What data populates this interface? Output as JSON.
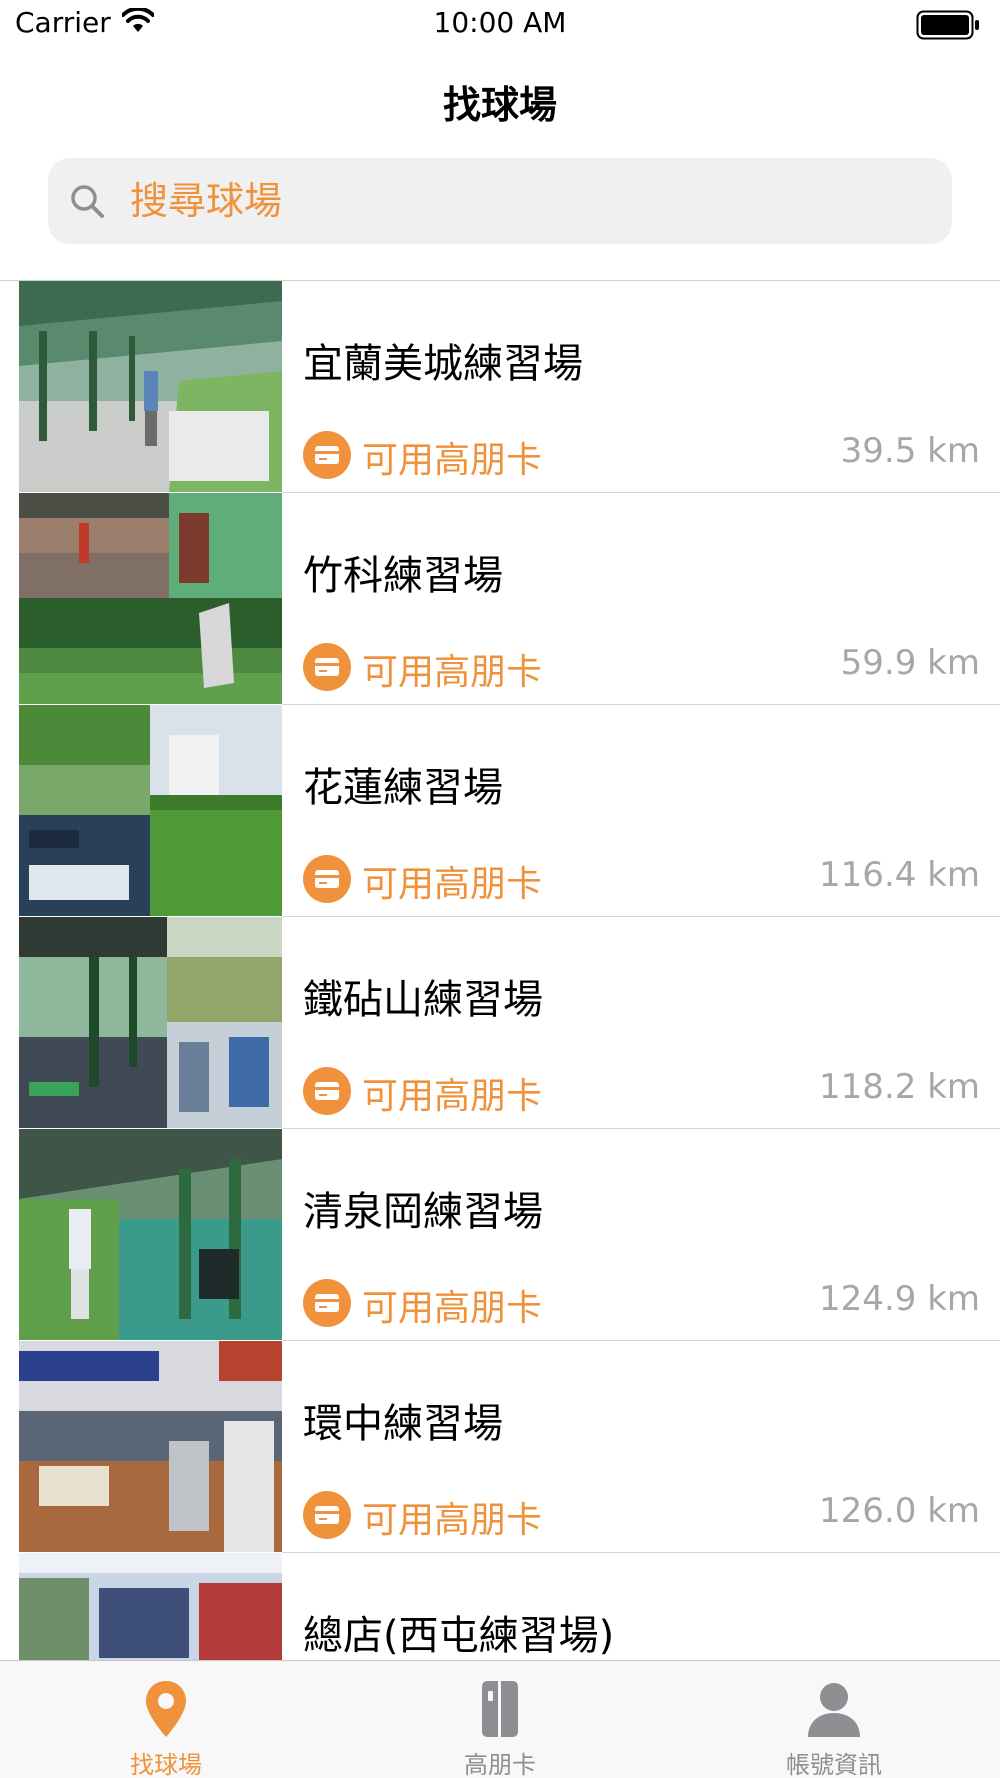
{
  "status_bar": {
    "carrier": "Carrier",
    "time": "10:00 AM"
  },
  "nav": {
    "title": "找球場"
  },
  "search": {
    "placeholder": "搜尋球場"
  },
  "colors": {
    "accent": "#f0923c",
    "distance_text": "#a7a7a7",
    "tab_inactive": "#8e8e93"
  },
  "courses": [
    {
      "name": "宜蘭美城練習場",
      "card_label": "可用高朋卡",
      "distance": "39.5 km"
    },
    {
      "name": "竹科練習場",
      "card_label": "可用高朋卡",
      "distance": "59.9 km"
    },
    {
      "name": "花蓮練習場",
      "card_label": "可用高朋卡",
      "distance": "116.4 km"
    },
    {
      "name": "鐵砧山練習場",
      "card_label": "可用高朋卡",
      "distance": "118.2 km"
    },
    {
      "name": "清泉岡練習場",
      "card_label": "可用高朋卡",
      "distance": "124.9 km"
    },
    {
      "name": "環中練習場",
      "card_label": "可用高朋卡",
      "distance": "126.0 km"
    },
    {
      "name": "總店(西屯練習場)",
      "card_label": "",
      "distance": ""
    }
  ],
  "tab_bar": {
    "tabs": [
      {
        "label": "找球場",
        "icon": "location-pin-icon",
        "active": true
      },
      {
        "label": "高朋卡",
        "icon": "card-icon",
        "active": false
      },
      {
        "label": "帳號資訊",
        "icon": "person-icon",
        "active": false
      }
    ]
  }
}
